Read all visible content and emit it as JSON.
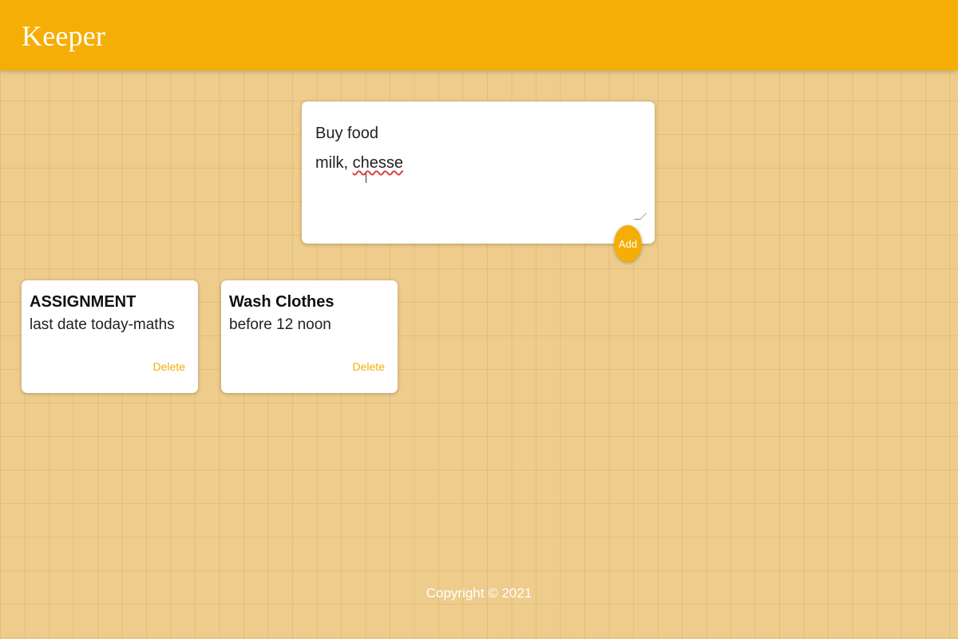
{
  "header": {
    "title": "Keeper"
  },
  "create_form": {
    "title_value": "Buy food",
    "content_value_prefix": "milk, ",
    "content_value_misspelled": "chesse",
    "add_label": "Add"
  },
  "notes": [
    {
      "title": "ASSIGNMENT",
      "content": "last date today-maths",
      "delete_label": "Delete"
    },
    {
      "title": "Wash Clothes",
      "content": "before 12 noon",
      "delete_label": "Delete"
    }
  ],
  "footer": {
    "copyright": "Copyright © 2021"
  },
  "colors": {
    "accent": "#f5ae05",
    "background": "#eecc8c",
    "card": "#ffffff"
  }
}
